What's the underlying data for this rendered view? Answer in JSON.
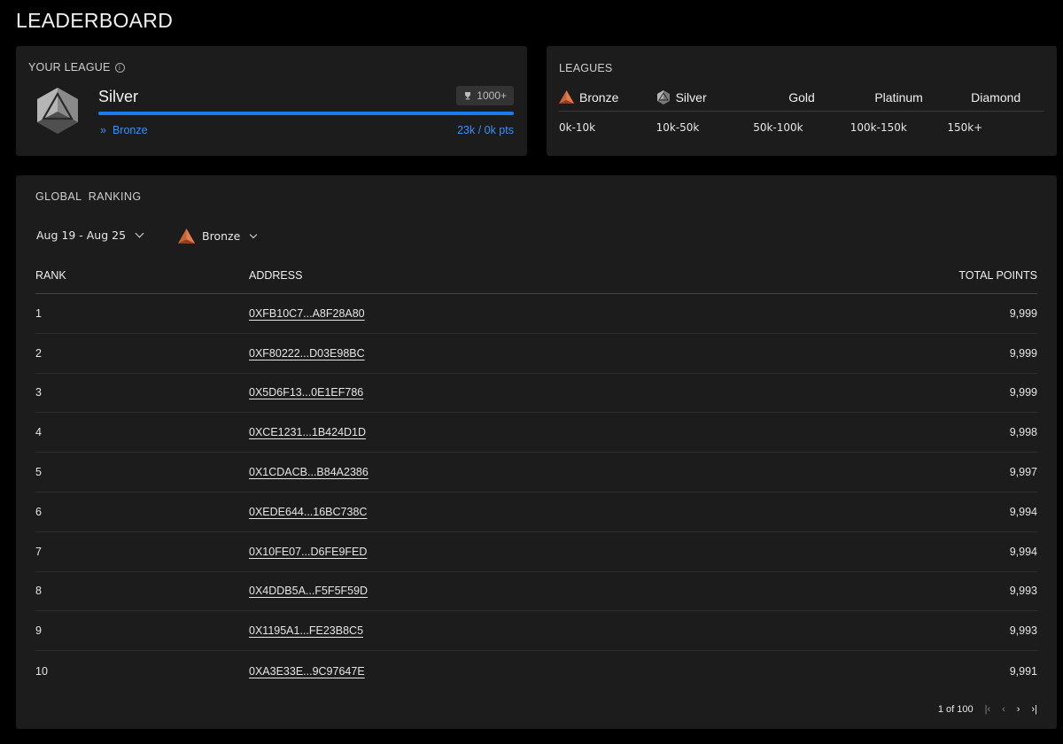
{
  "page": {
    "title": "LEADERBOARD"
  },
  "your_league": {
    "label": "YOUR LEAGUE",
    "name": "Silver",
    "trophy_count": "1000+",
    "progress": 1.0,
    "previous_league": "Bronze",
    "points_text": "23k / 0k pts"
  },
  "leagues": {
    "label": "LEAGUES",
    "items": [
      {
        "name": "Bronze",
        "range": "0k-10k",
        "icon": "bronze-badge-icon"
      },
      {
        "name": "Silver",
        "range": "10k-50k",
        "icon": "silver-badge-icon"
      },
      {
        "name": "Gold",
        "range": "50k-100k"
      },
      {
        "name": "Platinum",
        "range": "100k-150k"
      },
      {
        "name": "Diamond",
        "range": "150k+"
      }
    ]
  },
  "ranking": {
    "label": "GLOBAL  RANKING",
    "date_filter": "Aug 19 - Aug 25",
    "league_filter": "Bronze",
    "columns": {
      "rank": "RANK",
      "address": "ADDRESS",
      "points": "TOTAL POINTS"
    },
    "rows": [
      {
        "rank": "1",
        "address": "0XFB10C7...A8F28A80",
        "points": "9,999"
      },
      {
        "rank": "2",
        "address": "0XF80222...D03E98BC",
        "points": "9,999"
      },
      {
        "rank": "3",
        "address": "0X5D6F13...0E1EF786",
        "points": "9,999"
      },
      {
        "rank": "4",
        "address": "0XCE1231...1B424D1D",
        "points": "9,998"
      },
      {
        "rank": "5",
        "address": "0X1CDACB...B84A2386",
        "points": "9,997"
      },
      {
        "rank": "6",
        "address": "0XEDE644...16BC738C",
        "points": "9,994"
      },
      {
        "rank": "7",
        "address": "0X10FE07...D6FE9FED",
        "points": "9,994"
      },
      {
        "rank": "8",
        "address": "0X4DDB5A...F5F5F59D",
        "points": "9,993"
      },
      {
        "rank": "9",
        "address": "0X1195A1...FE23B8C5",
        "points": "9,993"
      },
      {
        "rank": "10",
        "address": "0XA3E33E...9C97647E",
        "points": "9,991"
      }
    ],
    "pagination": {
      "text": "1 of 100",
      "first": "|‹",
      "prev": "‹",
      "next": "›",
      "last": "›|"
    }
  },
  "colors": {
    "accent": "#1a7ef0",
    "bronze": "#c8643a",
    "silver": "#9a9a9a",
    "card": "#1c1c1c"
  }
}
